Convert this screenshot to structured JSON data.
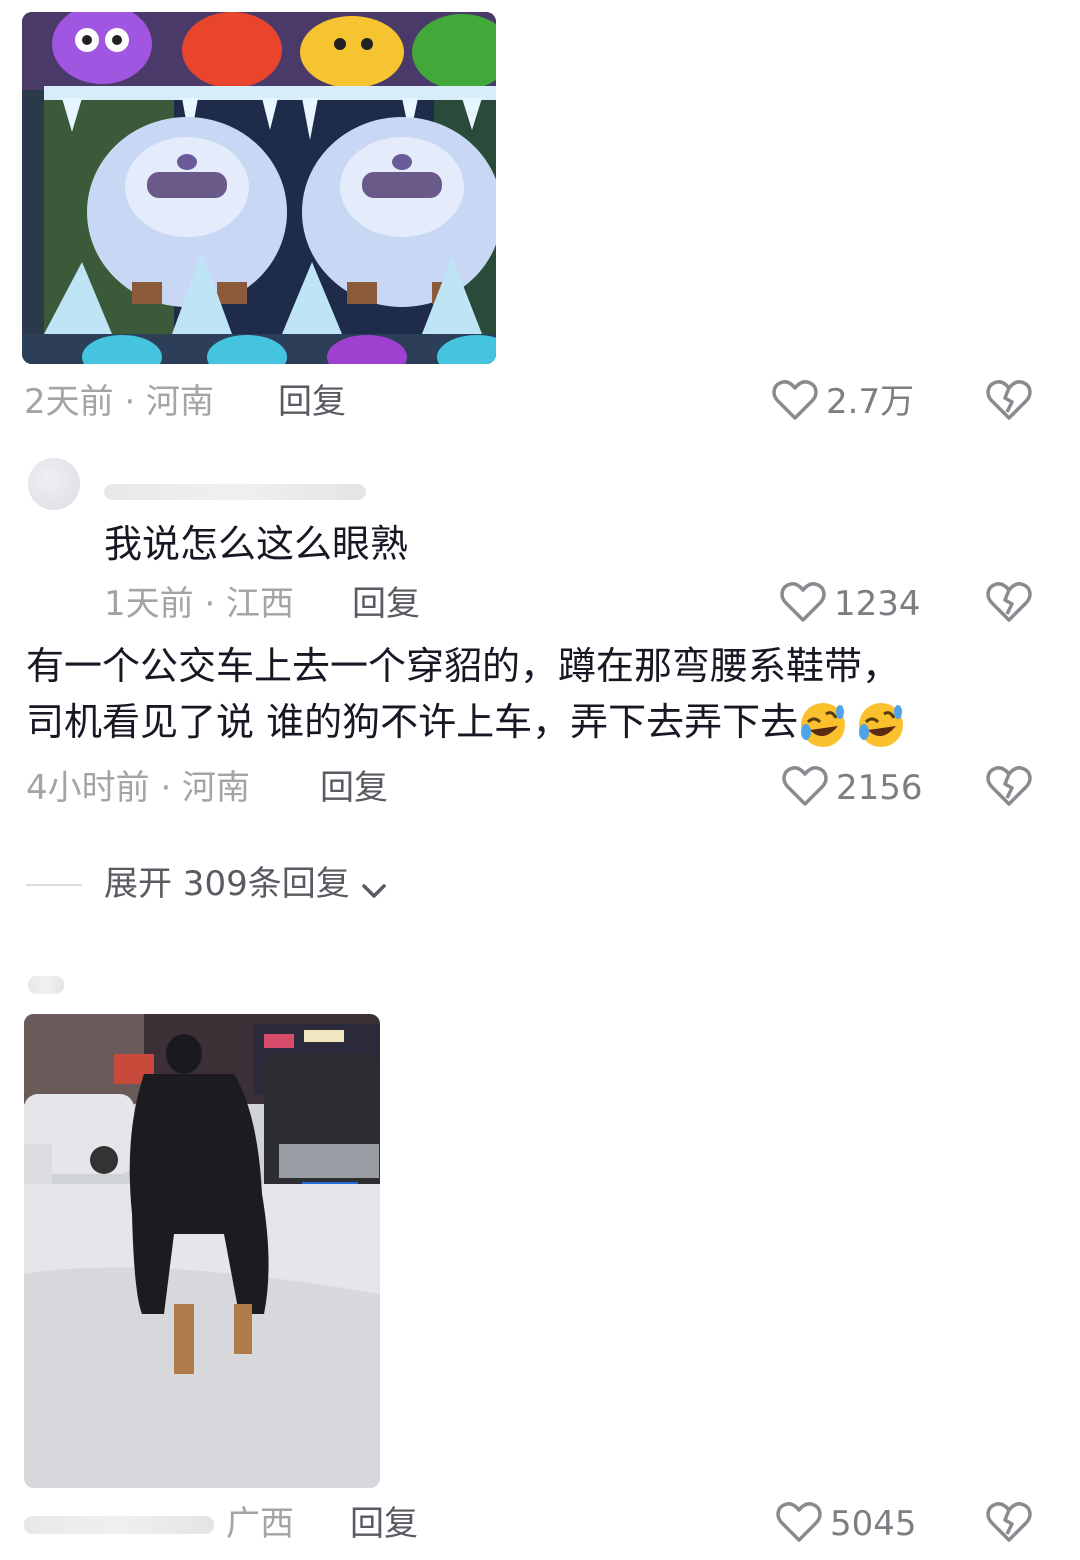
{
  "comments": [
    {
      "image": "game-screenshot",
      "time_location": "2天前 · 河南",
      "reply_label": "回复",
      "like_count": "2.7万"
    },
    {
      "text": "我说怎么这么眼熟",
      "time_location": "1天前 · 江西",
      "reply_label": "回复",
      "like_count": "1234"
    },
    {
      "text_line1": "有一个公交车上去一个穿貂的，蹲在那弯腰系鞋带，",
      "text_line2": "司机看见了说 谁的狗不许上车，弄下去弄下去",
      "time_location": "4小时前 · 河南",
      "reply_label": "回复",
      "like_count": "2156"
    },
    {
      "image": "street-photo",
      "time_location": "广西",
      "reply_label": "回复",
      "like_count": "5045"
    }
  ],
  "expand_replies": "展开 309条回复",
  "icons": {
    "like": "heart-outline-icon",
    "dislike": "broken-heart-icon",
    "expand": "chevron-down-icon",
    "emoji": "rolling-laughing-emoji"
  },
  "colors": {
    "meta_gray": "#a3a3a8",
    "text_dark": "#161823"
  }
}
